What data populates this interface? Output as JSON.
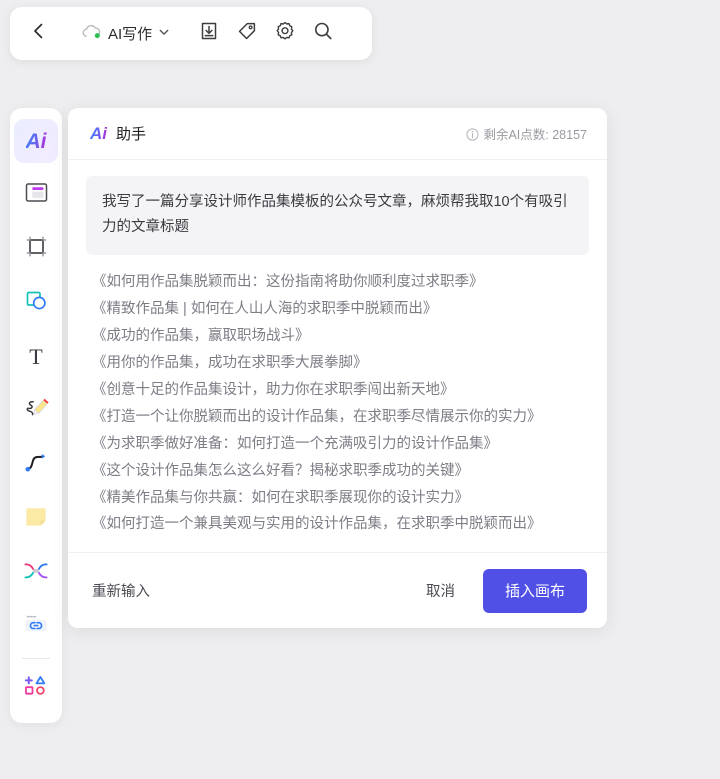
{
  "toolbar": {
    "back_icon": "chevron-left-icon",
    "cloud_icon": "cloud-sync-icon",
    "doc_title": "AI写作",
    "dropdown_icon": "chevron-down-icon",
    "download_icon": "download-icon",
    "tag_icon": "tag-icon",
    "settings_icon": "gear-icon",
    "search_icon": "search-icon"
  },
  "sidebar": {
    "items": [
      {
        "name": "ai-assistant",
        "icon": "ai-icon",
        "label": "Ai",
        "active": true
      },
      {
        "name": "template",
        "icon": "template-icon",
        "active": false
      },
      {
        "name": "frame",
        "icon": "frame-icon",
        "active": false
      },
      {
        "name": "shape",
        "icon": "shape-icon",
        "active": false
      },
      {
        "name": "text",
        "icon": "text-icon",
        "label": "T",
        "active": false
      },
      {
        "name": "pen",
        "icon": "pencil-scribble-icon",
        "active": false
      },
      {
        "name": "curve",
        "icon": "bezier-curve-icon",
        "active": false
      },
      {
        "name": "sticky-note",
        "icon": "sticky-note-icon",
        "active": false
      },
      {
        "name": "connector",
        "icon": "connector-icon",
        "active": false
      },
      {
        "name": "link",
        "icon": "link-card-icon",
        "active": false
      },
      {
        "name": "more-shapes",
        "icon": "more-shapes-icon",
        "active": false
      }
    ]
  },
  "ai_panel": {
    "logo": "Ai",
    "title": "助手",
    "credits_icon": "info-icon",
    "credits_label": "剩余AI点数: 28157",
    "prompt": "我写了一篇分享设计师作品集模板的公众号文章，麻烦帮我取10个有吸引力的文章标题",
    "result": "《如何用作品集脱颖而出：这份指南将助你顺利度过求职季》\n《精致作品集 | 如何在人山人海的求职季中脱颖而出》\n《成功的作品集，赢取职场战斗》\n《用你的作品集，成功在求职季大展拳脚》\n《创意十足的作品集设计，助力你在求职季闯出新天地》\n《打造一个让你脱颖而出的设计作品集，在求职季尽情展示你的实力》\n《为求职季做好准备：如何打造一个充满吸引力的设计作品集》\n《这个设计作品集怎么这么好看？揭秘求职季成功的关键》\n《精美作品集与你共赢：如何在求职季展现你的设计实力》\n《如何打造一个兼具美观与实用的设计作品集，在求职季中脱颖而出》",
    "retry_label": "重新输入",
    "cancel_label": "取消",
    "insert_label": "插入画布"
  },
  "colors": {
    "page_background": "#eeeef0",
    "panel_background": "#ffffff",
    "primary_button": "#5050e6",
    "prompt_background": "#f4f4f7",
    "result_text": "#7d7d86",
    "muted_text": "#9a9aa2"
  }
}
